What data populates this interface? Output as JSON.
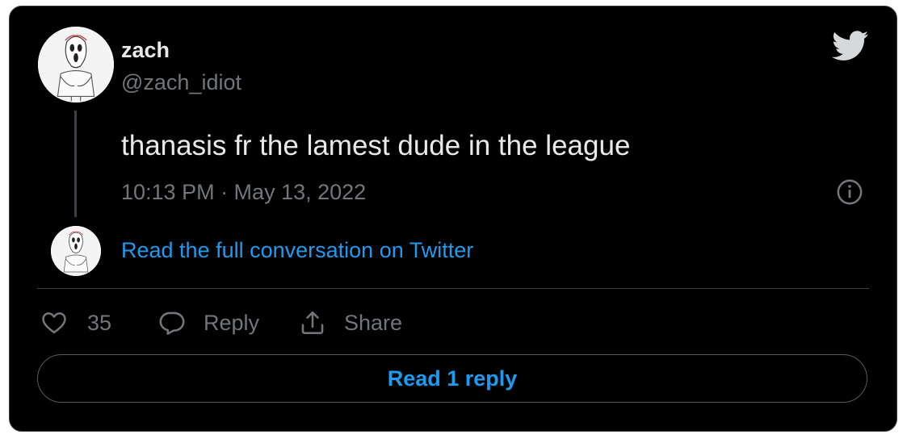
{
  "author": {
    "name": "zach",
    "handle": "@zach_idiot",
    "avatar_icon": "ghostface-avatar"
  },
  "tweet": {
    "text": "thanasis fr the lamest dude in the league",
    "timestamp": "10:13 PM · May 13, 2022"
  },
  "conversation_link": "Read the full conversation on Twitter",
  "actions": {
    "likes_count": "35",
    "reply_label": "Reply",
    "share_label": "Share"
  },
  "read_replies_label": "Read 1 reply",
  "icons": {
    "brand": "twitter-bird-icon",
    "info": "info-icon",
    "like": "heart-icon",
    "reply": "speech-bubble-icon",
    "share": "share-icon"
  },
  "colors": {
    "background": "#000000",
    "text_primary": "#e7e9ea",
    "text_secondary": "#71767b",
    "accent": "#1d9bf0",
    "border": "#3c4045"
  }
}
